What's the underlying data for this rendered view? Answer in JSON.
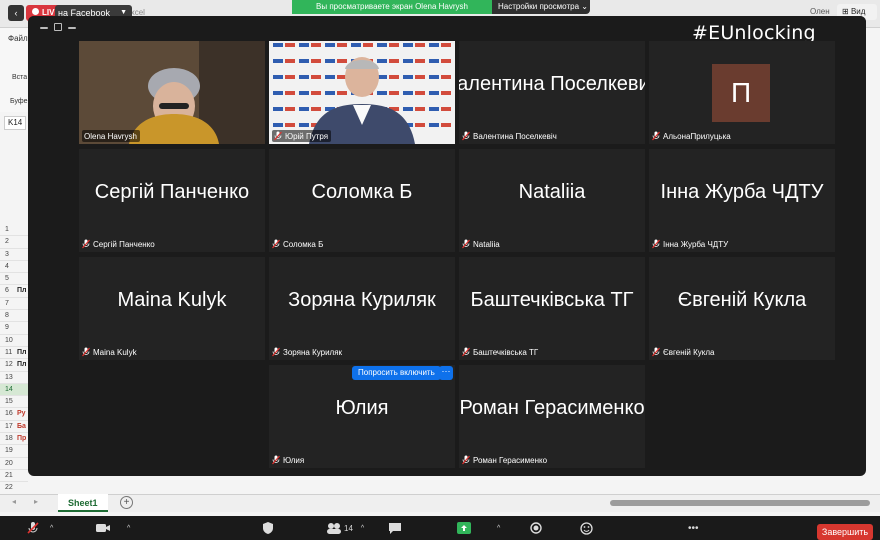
{
  "app": {
    "live_label": "LIVE",
    "stream_target": "на Facebook",
    "excel_title_tail": "й – Excel",
    "share_banner": "Вы просматриваете экран Olena Havrysh",
    "view_options": "Настройки просмотра",
    "top_right_user": "Олен",
    "view_button": "Вид",
    "hashtag": "#EUnlocking"
  },
  "excel": {
    "ribbon_tab": "Файл",
    "insert_label": "Вста",
    "buffer_label": "Буфе",
    "namebox": "K14",
    "rows": [
      {
        "n": "1",
        "t": ""
      },
      {
        "n": "2",
        "t": ""
      },
      {
        "n": "3",
        "t": ""
      },
      {
        "n": "4",
        "t": ""
      },
      {
        "n": "5",
        "t": ""
      },
      {
        "n": "6",
        "t": "Пл"
      },
      {
        "n": "7",
        "t": ""
      },
      {
        "n": "8",
        "t": ""
      },
      {
        "n": "9",
        "t": ""
      },
      {
        "n": "10",
        "t": ""
      },
      {
        "n": "11",
        "t": "Пл"
      },
      {
        "n": "12",
        "t": "Пл"
      },
      {
        "n": "13",
        "t": ""
      },
      {
        "n": "14",
        "t": ""
      },
      {
        "n": "15",
        "t": ""
      },
      {
        "n": "16",
        "t": "Ру"
      },
      {
        "n": "17",
        "t": "Ба"
      },
      {
        "n": "18",
        "t": "Пр"
      },
      {
        "n": "19",
        "t": ""
      },
      {
        "n": "20",
        "t": ""
      },
      {
        "n": "21",
        "t": ""
      },
      {
        "n": "22",
        "t": ""
      }
    ],
    "sheet_tab": "Sheet1",
    "add_sheet": "+"
  },
  "participants": [
    {
      "display": "",
      "label": "Olena Havrysh",
      "type": "video-person",
      "active": true
    },
    {
      "display": "",
      "label": "Юрій Путря",
      "type": "video-banner"
    },
    {
      "display": "Валентина Поселкевич",
      "label": "Валентина Поселкевіч"
    },
    {
      "display": "П",
      "label": "АльонаПрилуцька",
      "type": "avatar"
    },
    {
      "display": "Сергій Панченко",
      "label": "Сергій Панченко"
    },
    {
      "display": "Соломка Б",
      "label": "Соломка Б"
    },
    {
      "display": "Nataliia",
      "label": "Nataliia"
    },
    {
      "display": "Інна Журба ЧДТУ",
      "label": "Інна Журба ЧДТУ"
    },
    {
      "display": "Maina Kulyk",
      "label": "Maina Kulyk"
    },
    {
      "display": "Зоряна Куриляк",
      "label": "Зоряна Куриляк"
    },
    {
      "display": "Баштечківська ТГ",
      "label": "Баштечківська ТГ"
    },
    {
      "display": "Євгеній Кукла",
      "label": "Євгеній Кукла"
    },
    {
      "display": "Юлия",
      "label": "Юлия"
    },
    {
      "display": "Роман Герасименко",
      "label": "Роман Герасименко"
    }
  ],
  "allow_button": "Попросить включить",
  "allow_more": "···",
  "toolbar": {
    "participants_count": "14",
    "end_label": "Завершить"
  },
  "colors": {
    "active_speaker": "#e6e03a",
    "share_banner": "#31b55a",
    "end_button": "#d7372f",
    "avatar_bg": "#6a3c2f",
    "allow_button": "#0e71eb"
  }
}
